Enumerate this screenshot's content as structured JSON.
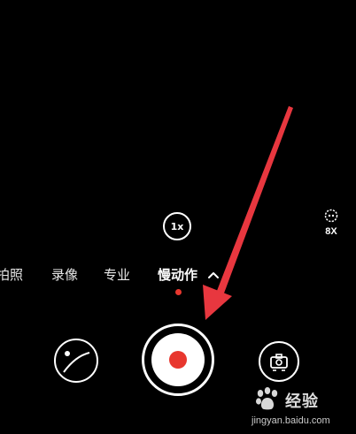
{
  "camera": {
    "zoom_label": "1x",
    "speed_label": "8X",
    "modes": [
      {
        "label": "拍照",
        "active": false
      },
      {
        "label": "录像",
        "active": false
      },
      {
        "label": "专业",
        "active": false
      },
      {
        "label": "慢动作",
        "active": true
      }
    ],
    "accent_color": "#e8372e"
  },
  "icons": {
    "gallery": "gallery-thumbnail-icon",
    "shutter": "record-shutter-icon",
    "switch_camera": "switch-camera-icon",
    "speed": "slow-motion-speed-icon",
    "more_modes": "chevron-up-icon"
  },
  "annotation": {
    "arrow_color": "#e8373f"
  },
  "watermark": {
    "brand": "经验",
    "url": "jingyan.baidu.com"
  }
}
